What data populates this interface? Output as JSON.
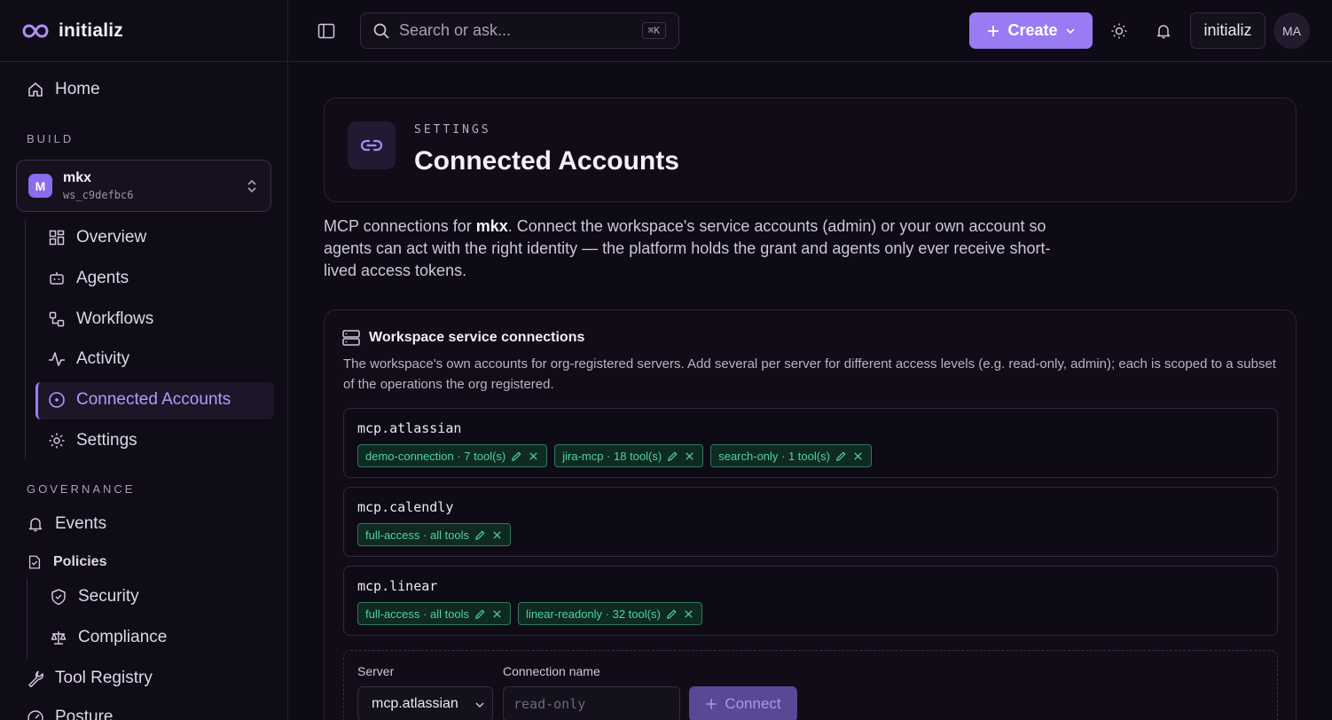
{
  "brand": {
    "name": "initializ"
  },
  "sidebar": {
    "home": "Home",
    "build_label": "BUILD",
    "workspace": {
      "avatar": "M",
      "name": "mkx",
      "id": "ws_c9defbc6"
    },
    "build_items": [
      {
        "label": "Overview"
      },
      {
        "label": "Agents"
      },
      {
        "label": "Workflows"
      },
      {
        "label": "Activity"
      },
      {
        "label": "Connected Accounts"
      },
      {
        "label": "Settings"
      }
    ],
    "governance_label": "GOVERNANCE",
    "events": "Events",
    "policies": "Policies",
    "policy_items": [
      {
        "label": "Security"
      },
      {
        "label": "Compliance"
      }
    ],
    "tool_registry": "Tool Registry",
    "posture": "Posture"
  },
  "topbar": {
    "search_placeholder": "Search or ask...",
    "search_shortcut": "⌘K",
    "create_label": "Create",
    "org_label": "initializ",
    "user_initials": "MA"
  },
  "header": {
    "eyebrow": "SETTINGS",
    "title": "Connected Accounts"
  },
  "intro": {
    "prefix": "MCP connections for ",
    "workspace": "mkx",
    "suffix": ". Connect the workspace's service accounts (admin) or your own account so agents can act with the right identity — the platform holds the grant and agents only ever receive short-lived access tokens."
  },
  "service_connections": {
    "title": "Workspace service connections",
    "description": "The workspace's own accounts for org-registered servers. Add several per server for different access levels (e.g. read-only, admin); each is scoped to a subset of the operations the org registered.",
    "servers": [
      {
        "name": "mcp.atlassian",
        "connections": [
          {
            "label": "demo-connection · 7 tool(s)"
          },
          {
            "label": "jira-mcp · 18 tool(s)"
          },
          {
            "label": "search-only · 1 tool(s)"
          }
        ]
      },
      {
        "name": "mcp.calendly",
        "connections": [
          {
            "label": "full-access · all tools"
          }
        ]
      },
      {
        "name": "mcp.linear",
        "connections": [
          {
            "label": "full-access · all tools"
          },
          {
            "label": "linear-readonly · 32 tool(s)"
          }
        ]
      }
    ],
    "form": {
      "server_label": "Server",
      "server_value": "mcp.atlassian",
      "name_label": "Connection name",
      "name_placeholder": "read-only",
      "connect_label": "Connect"
    }
  },
  "colors": {
    "accent": "#9a7bf4",
    "chip_green": "#4fd49a",
    "background": "#0e0a16"
  }
}
